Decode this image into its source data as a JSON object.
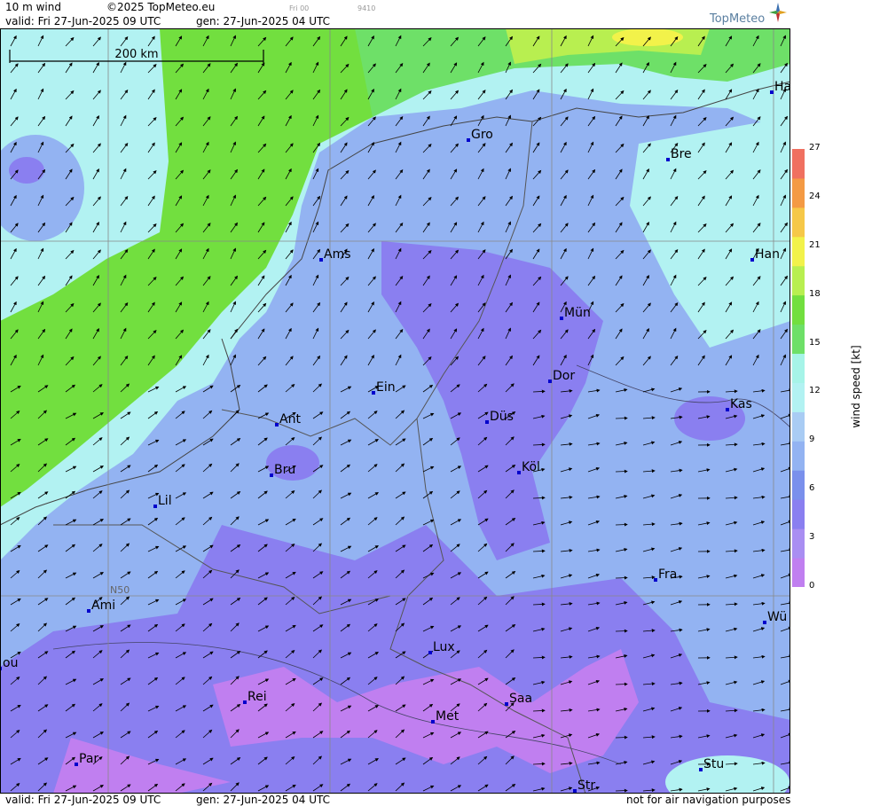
{
  "header": {
    "product": "10 m wind",
    "copyright": "©2025 TopMeteo.eu",
    "valid": "valid:  Fri  27-Jun-2025  09 UTC",
    "gen": "gen: 27-Jun-2025 04 UTC",
    "tiny_day": "Fri 00",
    "tiny_code": "9410",
    "logo": "TopMeteo"
  },
  "footer": {
    "valid": "valid:  Fri  27-Jun-2025  09 UTC",
    "gen": "gen: 27-Jun-2025 04 UTC",
    "notice": "not for air navigation purposes"
  },
  "scale_bar": {
    "label": "200 km"
  },
  "grid_label": "N50",
  "colorbar": {
    "title": "wind  speed  [kt]",
    "ticks": [
      "27",
      "24",
      "21",
      "18",
      "15",
      "12",
      "9",
      "6",
      "3",
      "0"
    ],
    "colors": [
      "#c07ff0",
      "#a98ef2",
      "#8a7ff0",
      "#7a90ec",
      "#93b3f2",
      "#a9ccf4",
      "#b2f2f2",
      "#a6f4e8",
      "#6ee068",
      "#72df3f",
      "#b8ef50",
      "#f2f24a",
      "#f6c848",
      "#f49a44",
      "#f07060"
    ]
  },
  "cities": [
    {
      "name": "Gro"
    },
    {
      "name": "Bre"
    },
    {
      "name": "Ha"
    },
    {
      "name": "Ams"
    },
    {
      "name": "Han"
    },
    {
      "name": "Mün"
    },
    {
      "name": "Dor"
    },
    {
      "name": "Ein"
    },
    {
      "name": "Kas"
    },
    {
      "name": "Ant"
    },
    {
      "name": "Düs"
    },
    {
      "name": "Bru"
    },
    {
      "name": "Köl"
    },
    {
      "name": "Lil"
    },
    {
      "name": "Fra"
    },
    {
      "name": "Ami"
    },
    {
      "name": "Wü"
    },
    {
      "name": "Lux"
    },
    {
      "name": "ou"
    },
    {
      "name": "Rei"
    },
    {
      "name": "Saa"
    },
    {
      "name": "Met"
    },
    {
      "name": "Par"
    },
    {
      "name": "Stu"
    },
    {
      "name": "Str"
    }
  ]
}
